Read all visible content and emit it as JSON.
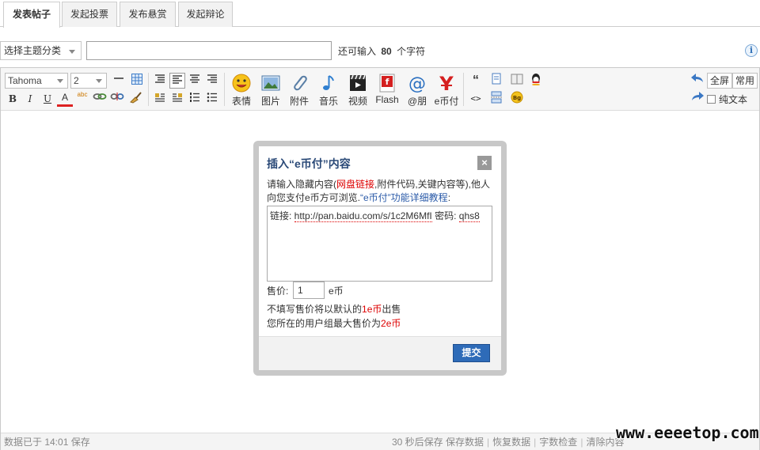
{
  "tabs": [
    {
      "label": "发表帖子",
      "active": true
    },
    {
      "label": "发起投票",
      "active": false
    },
    {
      "label": "发布悬赏",
      "active": false
    },
    {
      "label": "发起辩论",
      "active": false
    }
  ],
  "subject": {
    "type_select": "选择主题分类",
    "input_value": "",
    "hint_prefix": "还可输入",
    "hint_count": "80",
    "hint_suffix": "个字符",
    "info_icon": "i"
  },
  "toolbar": {
    "font_family": "Tahoma",
    "font_size": "2",
    "format_icons": {
      "bold": "B",
      "italic": "I",
      "underline": "U",
      "color": "A",
      "spell": "abc"
    },
    "big_buttons": [
      {
        "label": "表情",
        "icon": "smiley-icon"
      },
      {
        "label": "图片",
        "icon": "image-icon"
      },
      {
        "label": "附件",
        "icon": "paperclip-icon"
      },
      {
        "label": "音乐",
        "icon": "music-icon"
      },
      {
        "label": "视频",
        "icon": "video-icon"
      },
      {
        "label": "Flash",
        "icon": "flash-icon"
      },
      {
        "label": "@朋",
        "icon": "at-icon"
      },
      {
        "label": "e币付",
        "icon": "yen-icon"
      }
    ],
    "quote_icon": "“",
    "code_icon": "<>",
    "fullscreen": "全屏",
    "common": "常用",
    "plain_text": "纯文本"
  },
  "status": {
    "left": "数据已于 14:01 保存",
    "right": [
      "30 秒后保存 保存数据",
      "恢复数据",
      "字数检查",
      "清除内容"
    ]
  },
  "watermark": "www.eeeetop.com",
  "dialog": {
    "title": "插入“e币付”内容",
    "close": "×",
    "desc_1": "请输入隐藏内容(",
    "desc_red": "网盘链接",
    "desc_2": ",附件代码,关键内容等),他人向您支付e币方可浏览.",
    "desc_link": "“e币付”功能详细教程",
    "desc_end": ":",
    "content_label": "链接: ",
    "content_url": "http://pan.baidu.com/s/1c2M6MfI",
    "content_pwd_label": " 密码: ",
    "content_pwd": "qhs8",
    "price_label": "售价:",
    "price_value": "1",
    "price_unit": "e币",
    "note1_prefix": "不填写售价将以默认的",
    "note1_red": "1e币",
    "note1_suffix": "出售",
    "note2_prefix": "您所在的用户组最大售价为",
    "note2_red": "2e币",
    "submit": "提交"
  }
}
